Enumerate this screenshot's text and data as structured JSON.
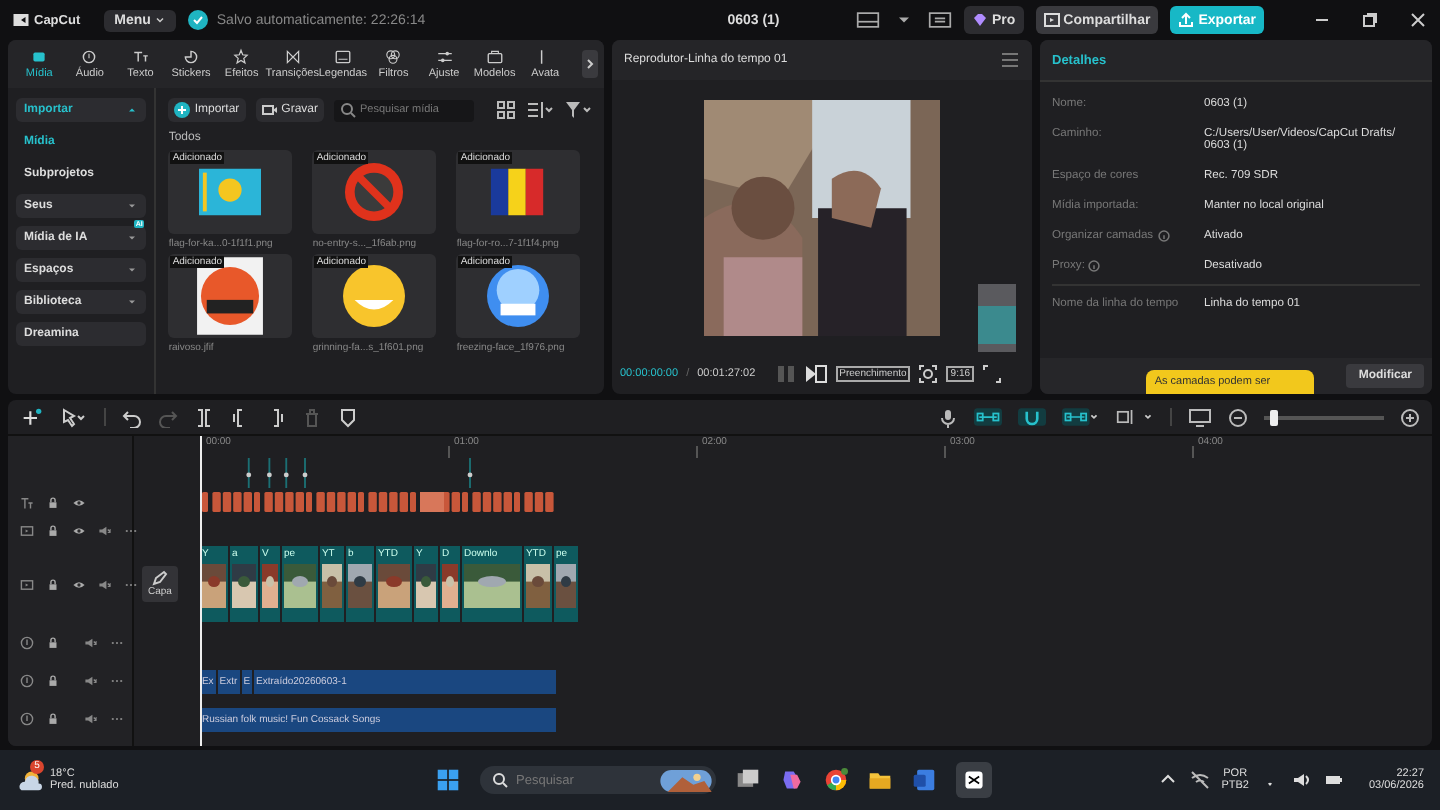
{
  "top_bar": {
    "logo": "CapCut",
    "menu": "Menu",
    "autosave": "Salvo automaticamente: 22:26:14",
    "project_title": "0603 (1)",
    "pro": "Pro",
    "share": "Compartilhar",
    "export": "Exportar"
  },
  "tool_tabs": [
    {
      "label": "Mídia",
      "selected": true
    },
    {
      "label": "Áudio",
      "selected": false
    },
    {
      "label": "Texto",
      "selected": false
    },
    {
      "label": "Stickers",
      "selected": false
    },
    {
      "label": "Efeitos",
      "selected": false
    },
    {
      "label": "Transições",
      "selected": false
    },
    {
      "label": "Legendas",
      "selected": false
    },
    {
      "label": "Filtros",
      "selected": false
    },
    {
      "label": "Ajuste",
      "selected": false
    },
    {
      "label": "Modelos",
      "selected": false
    },
    {
      "label": "Avata",
      "selected": false
    }
  ],
  "media_sidebar": [
    {
      "label": "Importar",
      "kind": "group",
      "expanded": true,
      "selected": true
    },
    {
      "label": "Mídia",
      "kind": "sub",
      "selected": true
    },
    {
      "label": "Subprojetos",
      "kind": "sub",
      "selected": false
    },
    {
      "label": "Seus",
      "kind": "group",
      "expanded": false,
      "selected": false
    },
    {
      "label": "Mídia de IA",
      "kind": "group",
      "expanded": false,
      "selected": false,
      "badge": "AI"
    },
    {
      "label": "Espaços",
      "kind": "group",
      "expanded": false,
      "selected": false
    },
    {
      "label": "Biblioteca",
      "kind": "group",
      "expanded": false,
      "selected": false
    },
    {
      "label": "Dreamina",
      "kind": "plain",
      "selected": false
    }
  ],
  "media_toolbar": {
    "import": "Importar",
    "record": "Gravar",
    "search": {
      "placeholder": "Pesquisar mídia"
    }
  },
  "media_section": "Todos",
  "media_items": [
    {
      "badge": "Adicionado",
      "name": "flag-for-ka...0-1f1f1.png"
    },
    {
      "badge": "Adicionado",
      "name": "no-entry-s..._1f6ab.png"
    },
    {
      "badge": "Adicionado",
      "name": "flag-for-ro...7-1f1f4.png"
    },
    {
      "badge": "Adicionado",
      "name": "raivoso.jfif"
    },
    {
      "badge": "Adicionado",
      "name": "grinning-fa...s_1f601.png"
    },
    {
      "badge": "Adicionado",
      "name": "freezing-face_1f976.png"
    }
  ],
  "player": {
    "title": "Reprodutor-Linha do tempo 01",
    "time_current": "00:00:00:00",
    "separator": "/",
    "time_total": "00:01:27:02",
    "fill_mode": "Preenchimento",
    "ratio": "9:16"
  },
  "details": {
    "title": "Detalhes",
    "rows": [
      {
        "label": "Nome:",
        "value": "0603 (1)",
        "info": false
      },
      {
        "label": "Caminho:",
        "value": "C:/Users/User/Videos/CapCut Drafts/ 0603 (1)",
        "info": false
      },
      {
        "label": "Espaço de cores",
        "value": "Rec. 709 SDR",
        "info": false
      },
      {
        "label": "Mídia importada:",
        "value": "Manter no local original",
        "info": false
      },
      {
        "label": "Organizar camadas",
        "value": "Ativado",
        "info": true
      },
      {
        "label": "Proxy:",
        "value": "Desativado",
        "info": true
      }
    ],
    "timeline_name": {
      "label": "Nome da linha do tempo",
      "value": "Linha do tempo 01"
    },
    "tooltip": "As camadas podem ser",
    "modify": "Modificar"
  },
  "timeline": {
    "ruler": [
      "00:00",
      "01:00",
      "02:00",
      "03:00",
      "04:00"
    ],
    "zoom": {
      "level": 0.05
    },
    "cover": "Capa",
    "tracks": [
      {
        "kind": "text"
      },
      {
        "kind": "overlay"
      },
      {
        "kind": "video",
        "clips": [
          "Y",
          "a",
          "V",
          "pe",
          "YT",
          "b",
          "YTD",
          "Y",
          "D",
          "Downlo",
          "YTD",
          "pe"
        ]
      },
      {
        "kind": "audio"
      },
      {
        "kind": "audio",
        "clips": [
          "Ex",
          "Extr",
          "E",
          "Extraído20260603-1"
        ]
      },
      {
        "kind": "audio",
        "clips": [
          "Russian folk music! Fun Cossack Songs"
        ]
      }
    ]
  },
  "taskbar": {
    "weather_badge": "5",
    "temperature": "18°C",
    "weather": "Pred. nublado",
    "search": {
      "placeholder": "Pesquisar"
    },
    "language": "POR",
    "layout": "PTB2",
    "time": "22:27",
    "date": "03/06/2026"
  }
}
